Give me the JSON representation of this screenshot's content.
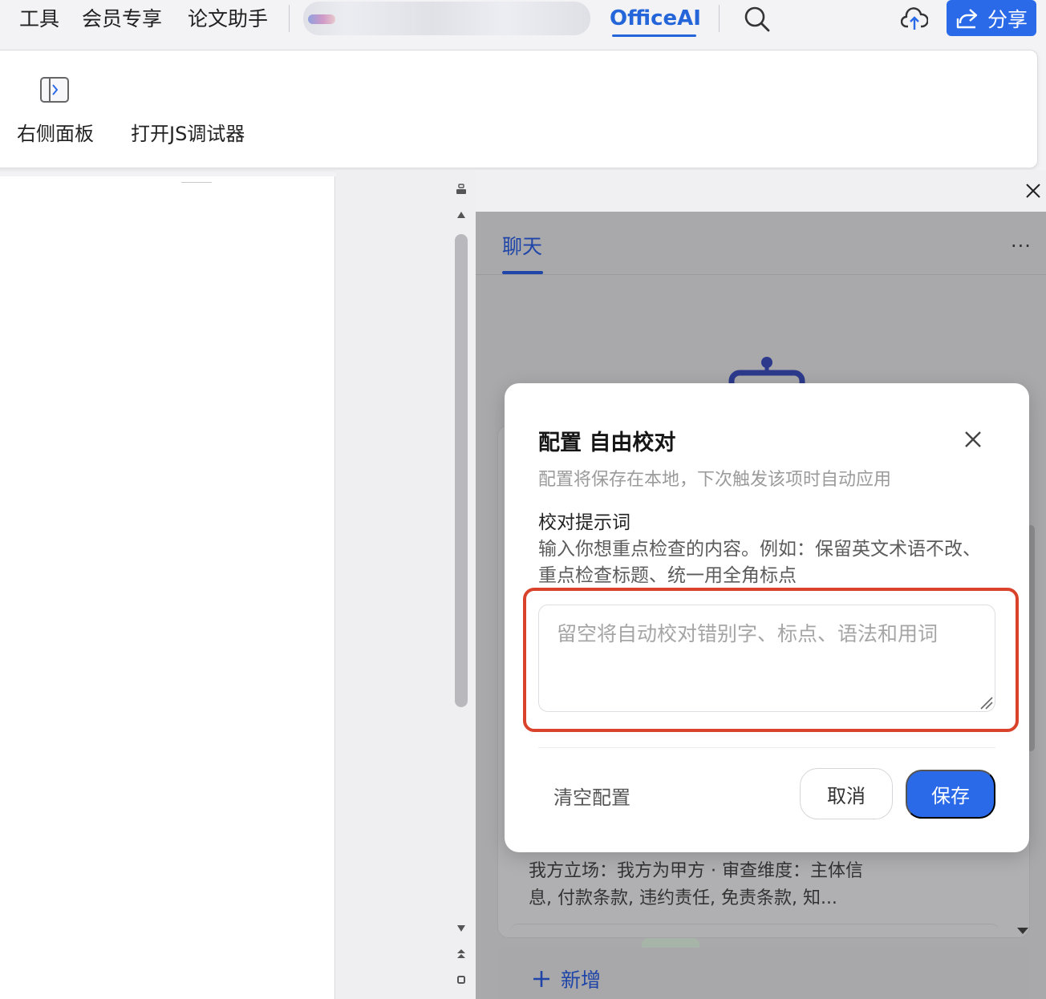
{
  "menubar": {
    "items": [
      {
        "label": "工具"
      },
      {
        "label": "会员专享"
      },
      {
        "label": "论文助手"
      }
    ],
    "active_tab": "OfficeAI",
    "share_label": "分享"
  },
  "ribbon": {
    "right_panel_label": "右侧面板",
    "js_debugger_label": "打开JS调试器"
  },
  "panel": {
    "tab_label": "聊天",
    "more_label": "···",
    "card_text": "我方立场：我方为甲方 · 审查维度：主体信息, 付款条款, 违约责任, 免责条款, 知...",
    "add_label": "新增"
  },
  "modal": {
    "title": "配置 自由校对",
    "subtitle": "配置将保存在本地，下次触发该项时自动应用",
    "field_label": "校对提示词",
    "field_help": "输入你想重点检查的内容。例如：保留英文术语不改、重点检查标题、统一用全角标点",
    "input_placeholder": "留空将自动校对错别字、标点、语法和用词",
    "input_value": "",
    "clear_label": "清空配置",
    "cancel_label": "取消",
    "save_label": "保存"
  },
  "colors": {
    "accent": "#2a6ae9",
    "tab_active": "#2466d9",
    "highlight": "#d9422b",
    "overlay": "#a9a9ab"
  }
}
